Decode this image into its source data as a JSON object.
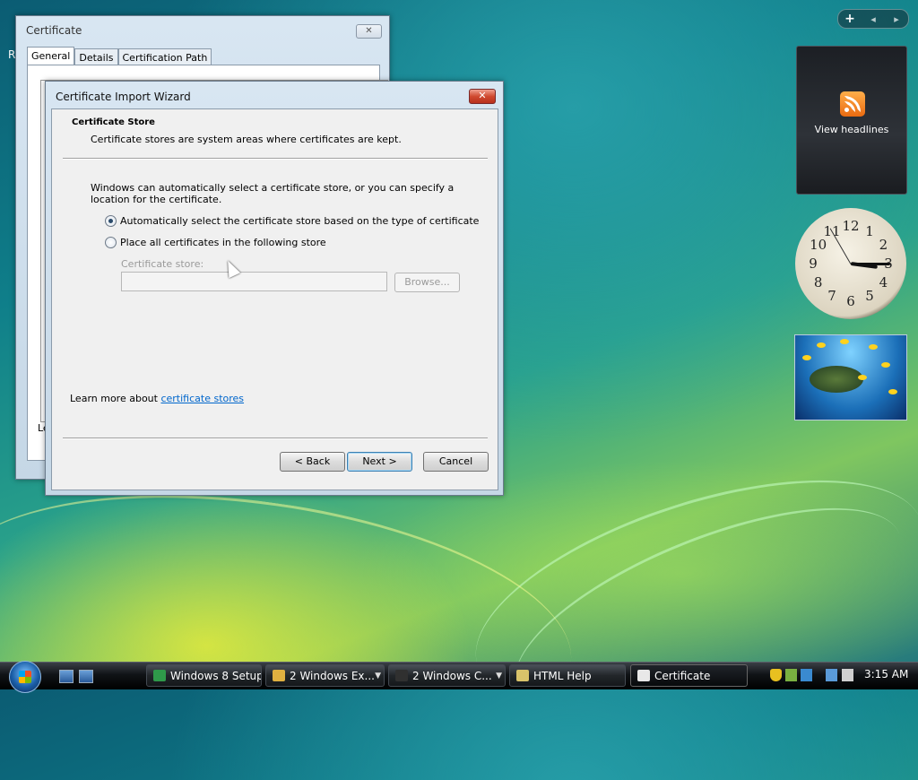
{
  "desktop": {
    "sidebar_controls": [
      "+",
      "◂",
      "▸"
    ],
    "feed_gadget": {
      "label": "View headlines"
    },
    "clock_gadget": {
      "numbers": [
        "12",
        "1",
        "2",
        "3",
        "4",
        "5",
        "6",
        "7",
        "8",
        "9",
        "10",
        "11"
      ],
      "time": "3:15"
    },
    "slideshow_gadget": {
      "subject": "sea turtle"
    }
  },
  "certificate_window": {
    "title": "Certificate",
    "close_label": "✕",
    "tabs": [
      "General",
      "Details",
      "Certification Path"
    ],
    "partial_left_text": "Le",
    "edge_text": "R"
  },
  "wizard": {
    "title": "Certificate Import Wizard",
    "close_label": "✕",
    "header_title": "Certificate Store",
    "header_subtitle": "Certificate stores are system areas where certificates are kept.",
    "intro": "Windows can automatically select a certificate store, or you can specify a location for the certificate.",
    "options": [
      {
        "label": "Automatically select the certificate store based on the type of certificate",
        "selected": true
      },
      {
        "label": "Place all certificates in the following store",
        "selected": false
      }
    ],
    "store_label": "Certificate store:",
    "store_value": "",
    "browse_label": "Browse...",
    "learn_prefix": "Learn more about ",
    "learn_link": "certificate stores",
    "back_label": "< Back",
    "next_label": "Next >",
    "cancel_label": "Cancel"
  },
  "taskbar": {
    "buttons": [
      {
        "label": "Windows 8 Setup",
        "color": "#2f9a4a",
        "grouped": false
      },
      {
        "label": "2 Windows Ex...",
        "color": "#e0b040",
        "grouped": true
      },
      {
        "label": "2 Windows C...",
        "color": "#303030",
        "grouped": true
      },
      {
        "label": "HTML Help",
        "color": "#d9c36a",
        "grouped": false
      },
      {
        "label": "Certificate",
        "color": "#e8e8e8",
        "grouped": false,
        "active": true
      }
    ],
    "time": "3:15 AM"
  }
}
